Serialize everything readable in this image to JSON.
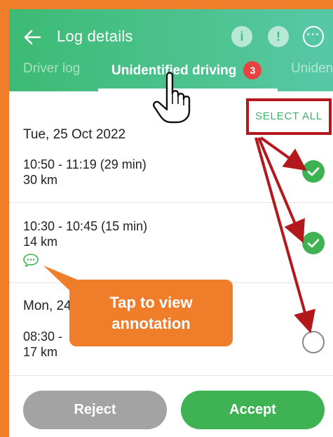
{
  "header": {
    "title": "Log details",
    "icons": [
      "info-icon",
      "alert-icon",
      "more-icon"
    ],
    "info_glyph": "i",
    "alert_glyph": "!",
    "more_glyph": "···"
  },
  "tabs": [
    {
      "label": "Driver log"
    },
    {
      "label": "Unidentified driving",
      "badge": "3"
    },
    {
      "label": "Uniden"
    }
  ],
  "select_all_label": "SELECT ALL",
  "groups": [
    {
      "date": "Tue, 25 Oct 2022",
      "entries": [
        {
          "time": "10:50 - 11:19 (29 min)",
          "distance": "30 km",
          "selected": true
        },
        {
          "time": "10:30 - 10:45 (15 min)",
          "distance": "14 km",
          "selected": true,
          "has_annotation": true
        }
      ]
    },
    {
      "date": "Mon, 24",
      "entries": [
        {
          "time": "08:30 -",
          "distance": "17 km",
          "selected": false
        }
      ]
    }
  ],
  "tooltip": {
    "line1": "Tap to view",
    "line2": "annotation"
  },
  "buttons": {
    "reject": "Reject",
    "accept": "Accept"
  },
  "colors": {
    "accent_green": "#3fb253",
    "highlight_orange": "#ef7d2a",
    "arrow_red": "#b3191c",
    "badge_red": "#e84343"
  }
}
